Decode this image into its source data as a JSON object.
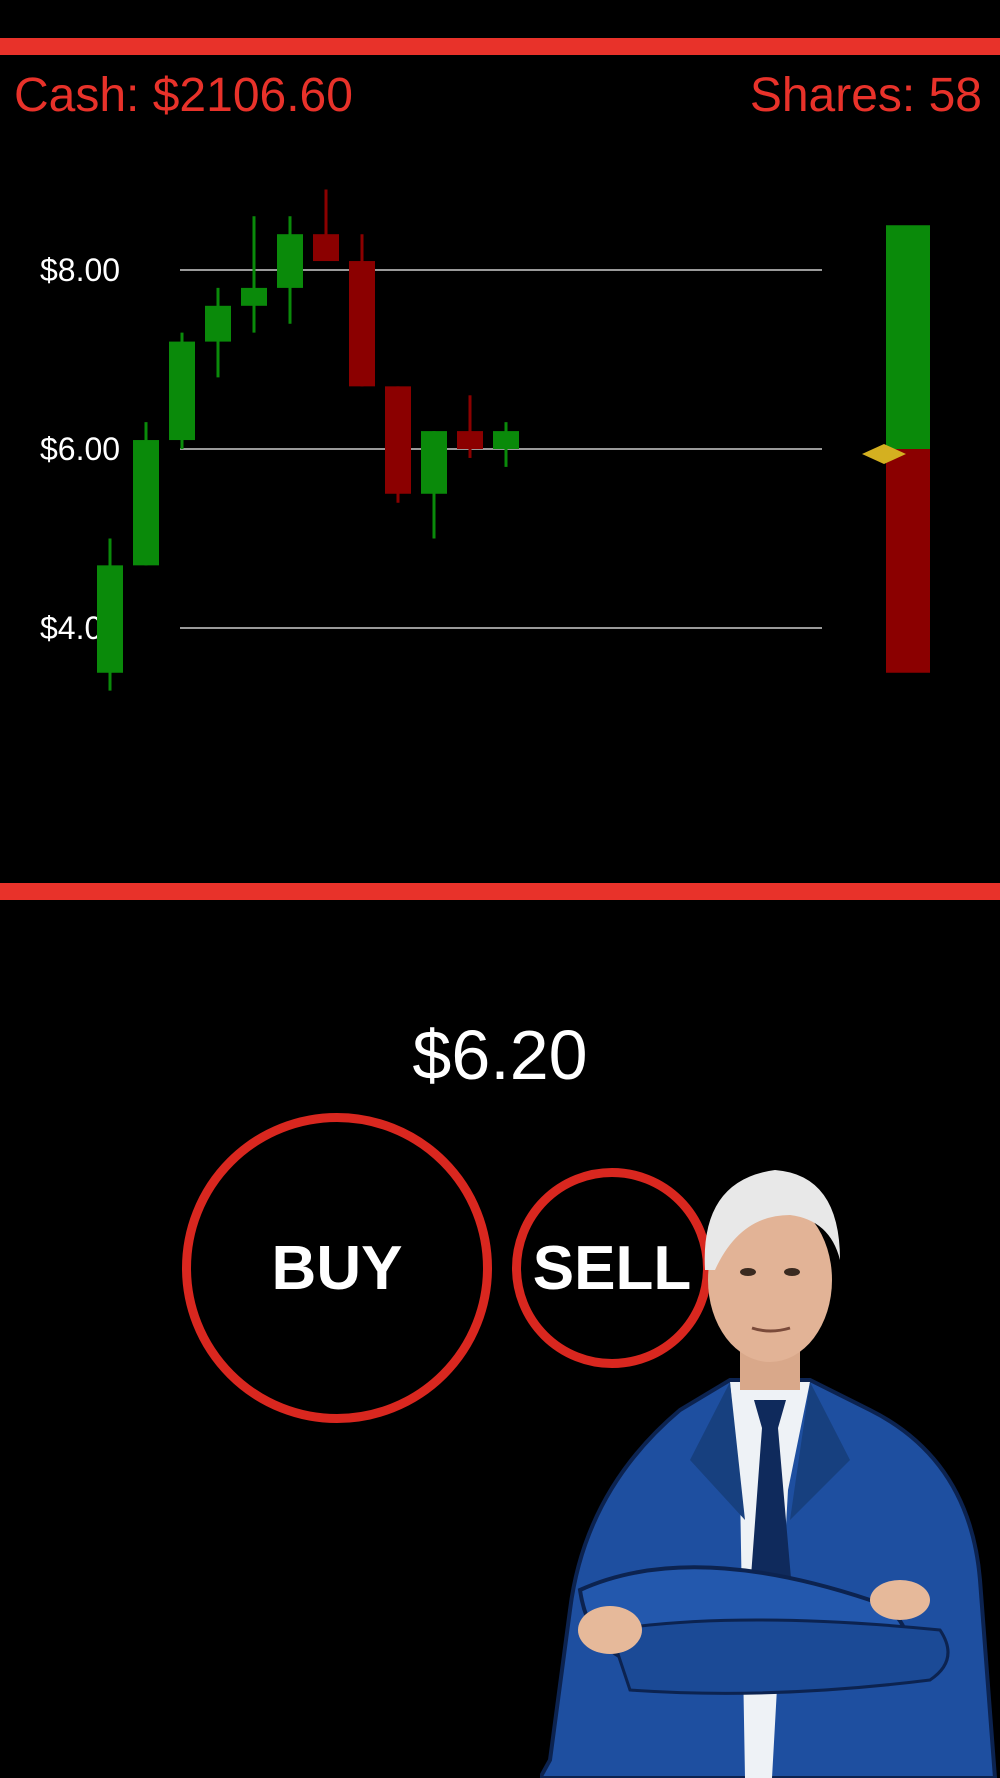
{
  "hud": {
    "cash": "Cash: $2106.60",
    "shares": "Shares: 58"
  },
  "current_price": "$6.20",
  "buttons": {
    "buy": "BUY",
    "sell": "SELL"
  },
  "colors": {
    "accent_red": "#e8322a",
    "candle_up": "#0a8a0a",
    "candle_down": "#8b0000",
    "gridline": "#9a9a9a",
    "marker": "#d4b020"
  },
  "chart_data": {
    "type": "candlestick",
    "y_tick_labels": [
      "$8.00",
      "$6.00",
      "$4.00"
    ],
    "y_ticks": [
      8,
      6,
      4
    ],
    "candles": [
      {
        "open": 3.5,
        "close": 4.7,
        "low": 3.3,
        "high": 5.0
      },
      {
        "open": 4.7,
        "close": 6.1,
        "low": 4.7,
        "high": 6.3
      },
      {
        "open": 6.1,
        "close": 7.2,
        "low": 6.0,
        "high": 7.3
      },
      {
        "open": 7.2,
        "close": 7.6,
        "low": 6.8,
        "high": 7.8
      },
      {
        "open": 7.6,
        "close": 7.8,
        "low": 7.3,
        "high": 8.6
      },
      {
        "open": 7.8,
        "close": 8.4,
        "low": 7.4,
        "high": 8.6
      },
      {
        "open": 8.4,
        "close": 8.1,
        "low": 8.1,
        "high": 8.9
      },
      {
        "open": 8.1,
        "close": 6.7,
        "low": 6.7,
        "high": 8.4
      },
      {
        "open": 6.7,
        "close": 5.5,
        "low": 5.4,
        "high": 6.7
      },
      {
        "open": 5.5,
        "close": 6.2,
        "low": 5.0,
        "high": 6.2
      },
      {
        "open": 6.2,
        "close": 6.0,
        "low": 5.9,
        "high": 6.6
      },
      {
        "open": 6.0,
        "close": 6.2,
        "low": 5.8,
        "high": 6.3
      }
    ],
    "grid": true,
    "side_meter": {
      "current": 6.0,
      "top": 8.5,
      "bottom": 3.5
    }
  }
}
